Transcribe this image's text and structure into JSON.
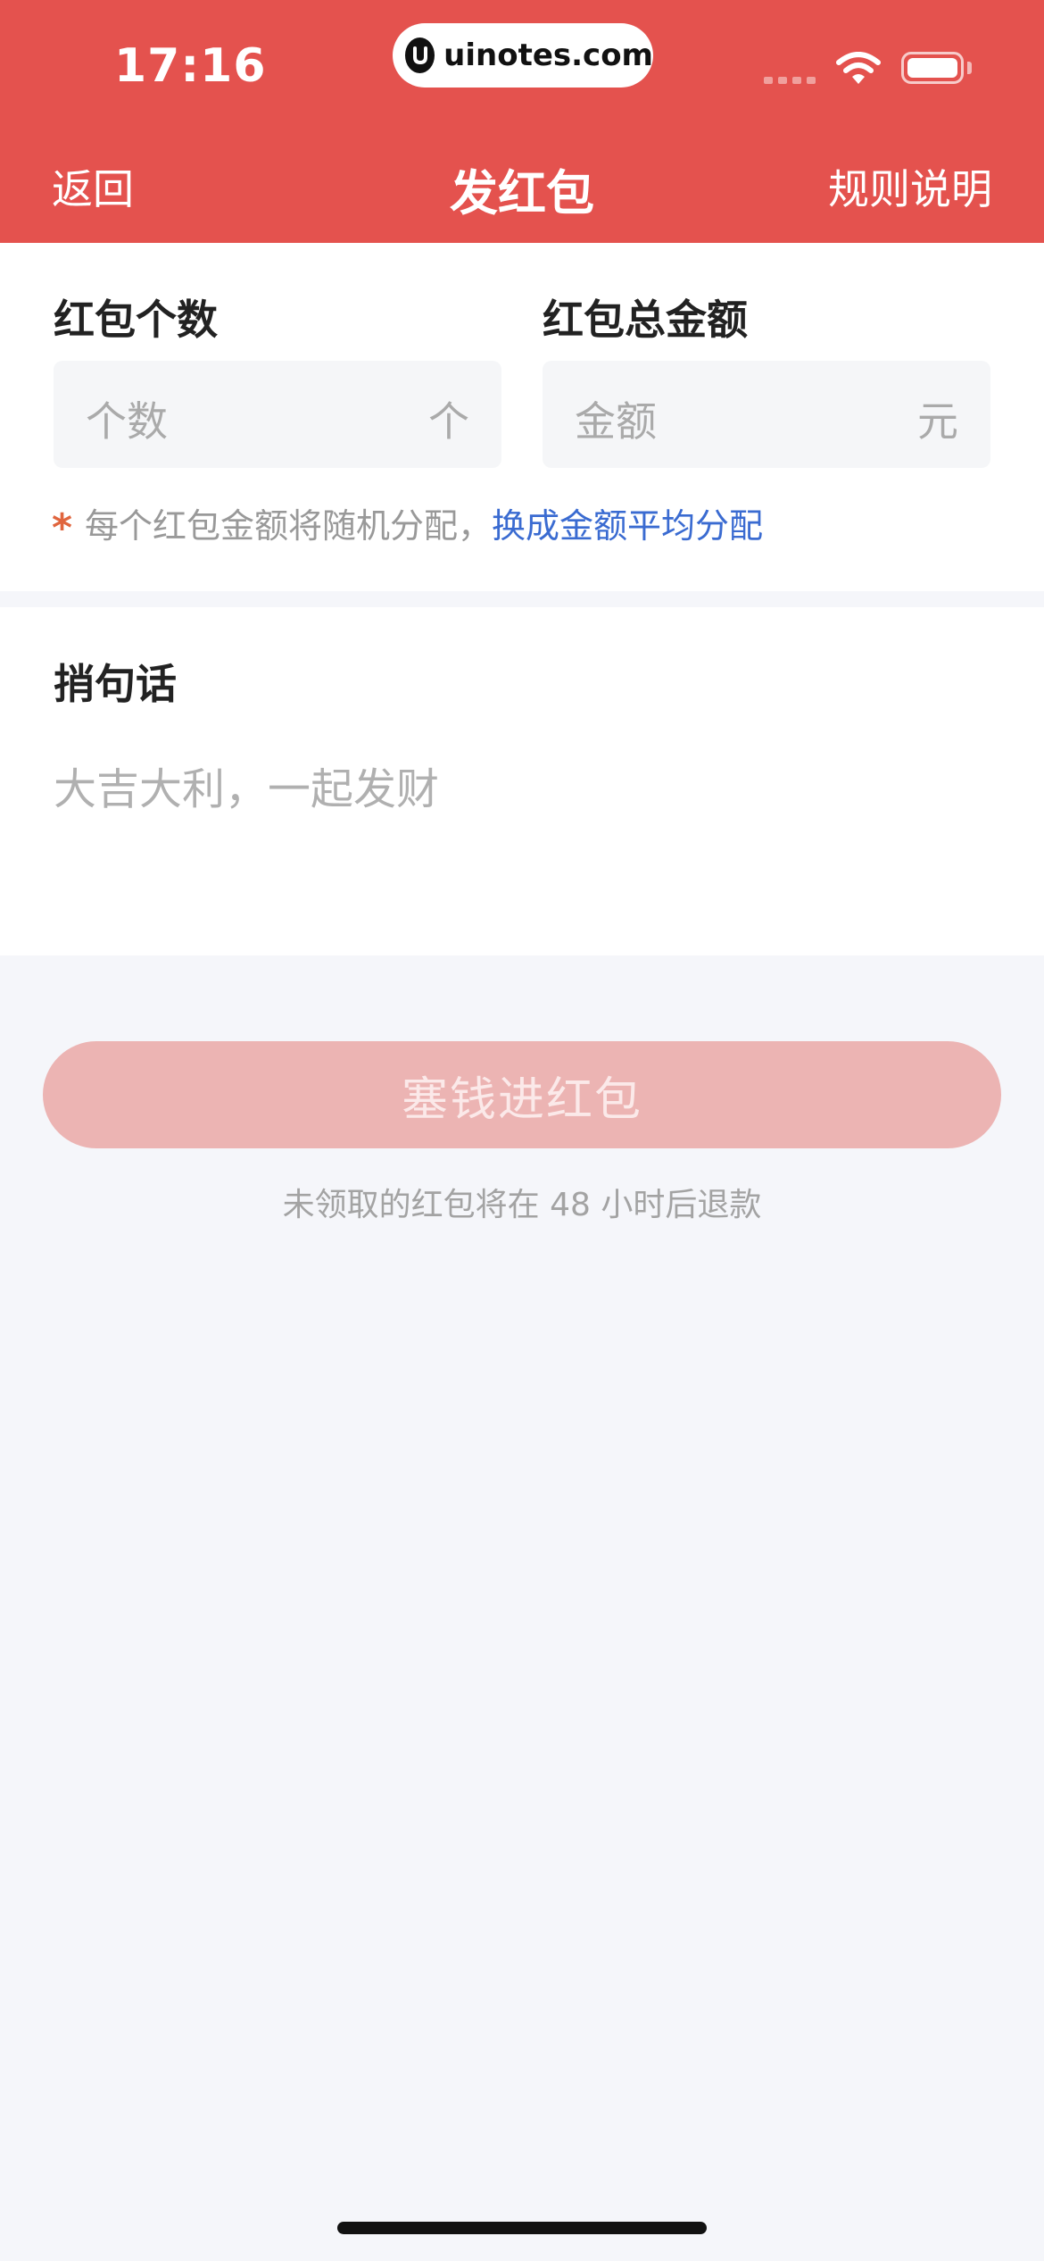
{
  "status_bar": {
    "time": "17:16",
    "url": "uinotes.com"
  },
  "nav": {
    "back": "返回",
    "title": "发红包",
    "rules": "规则说明"
  },
  "count_field": {
    "label": "红包个数",
    "placeholder": "个数",
    "unit": "个"
  },
  "amount_field": {
    "label": "红包总金额",
    "placeholder": "金额",
    "unit": "元"
  },
  "notice": {
    "star": "*",
    "text": "每个红包金额将随机分配，",
    "link": "换成金额平均分配"
  },
  "greeting": {
    "label": "捎句话",
    "placeholder": "大吉大利，一起发财"
  },
  "submit": {
    "label": "塞钱进红包"
  },
  "refund_note": "未领取的红包将在 48 小时后退款",
  "colors": {
    "header": "#e4524e",
    "link": "#3a6bd1",
    "button_disabled": "#ecb4b3"
  }
}
